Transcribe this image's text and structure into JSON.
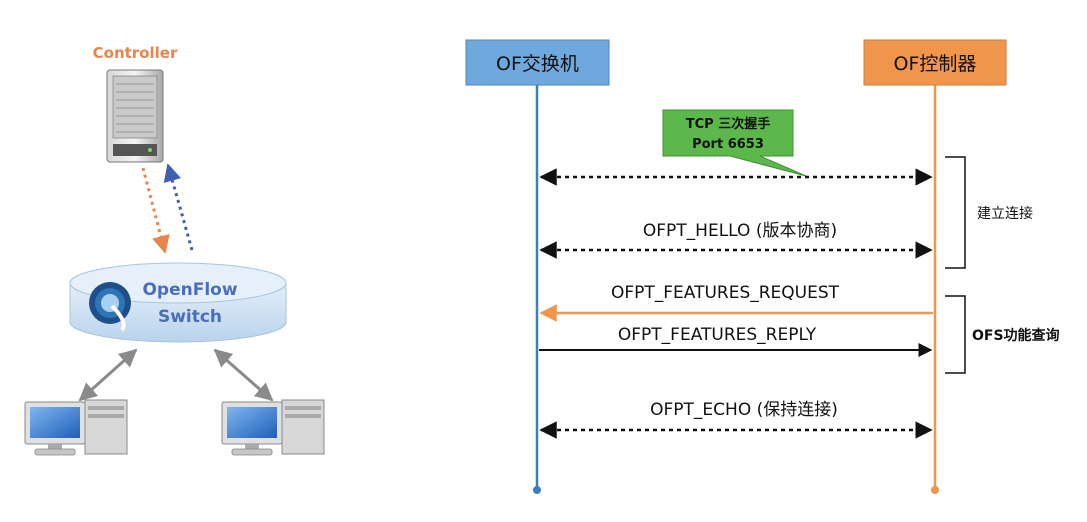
{
  "topology": {
    "controller_label": "Controller",
    "switch_label_line1": "OpenFlow",
    "switch_label_line2": "Switch"
  },
  "sequence": {
    "left_actor": "OF交换机",
    "right_actor": "OF控制器",
    "callout": {
      "line1": "TCP 三次握手",
      "line2": "Port 6653"
    },
    "messages": [
      {
        "label": "",
        "direction": "both",
        "style": "dashed"
      },
      {
        "label": "OFPT_HELLO (版本协商)",
        "direction": "both",
        "style": "dashed"
      },
      {
        "label": "OFPT_FEATURES_REQUEST",
        "direction": "to-left",
        "style": "solid"
      },
      {
        "label": "OFPT_FEATURES_REPLY",
        "direction": "to-right",
        "style": "solid"
      },
      {
        "label": "OFPT_ECHO (保持连接)",
        "direction": "both",
        "style": "dashed"
      }
    ],
    "phases": [
      {
        "label": "建立连接"
      },
      {
        "label": "OFS功能查询"
      }
    ]
  },
  "colors": {
    "left_actor": "#6FA8DC",
    "left_lifeline": "#3A7EC2",
    "right_actor": "#F0954C",
    "right_lifeline": "#F0954C",
    "callout": "#5DB84C",
    "controller_text": "#E8854A",
    "switch_body": "#CFE2F3",
    "switch_text": "#4A6FB8",
    "arrow_black": "#111111",
    "request_arrow": "#F0954C"
  }
}
